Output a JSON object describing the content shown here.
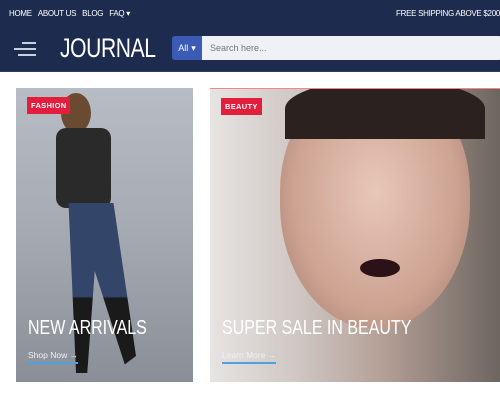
{
  "topbar": {
    "nav": [
      "HOME",
      "ABOUT US",
      "BLOG",
      "FAQ"
    ],
    "faq_caret": "▾",
    "shipping": "FREE SHIPPING ABOVE $200"
  },
  "header": {
    "logo": "JOURNAL",
    "category": "All",
    "caret": "▾",
    "search_placeholder": "Search here..."
  },
  "banners": [
    {
      "badge": "FASHION",
      "title": "NEW ARRIVALS",
      "link": "Shop Now →"
    },
    {
      "badge": "BEAUTY",
      "title": "SUPER SALE IN BEAUTY",
      "link": "Learn More →"
    }
  ],
  "colors": {
    "nav_bg": "#1d2b4f",
    "badge": "#e31e3c",
    "accent": "#3b5bb5",
    "link_underline": "#4da3dd"
  }
}
